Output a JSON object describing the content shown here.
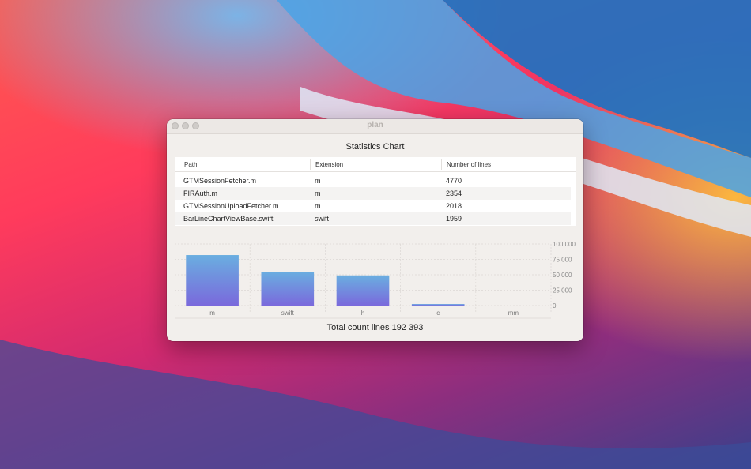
{
  "window": {
    "title": "plan"
  },
  "heading": "Statistics Chart",
  "table": {
    "columns": [
      "Path",
      "Extension",
      "Number of lines"
    ],
    "rows": [
      [
        "GTMSessionFetcher.m",
        "m",
        "4770"
      ],
      [
        "FIRAuth.m",
        "m",
        "2354"
      ],
      [
        "GTMSessionUploadFetcher.m",
        "m",
        "2018"
      ],
      [
        "BarLineChartViewBase.swift",
        "swift",
        "1959"
      ]
    ]
  },
  "chart_data": {
    "type": "bar",
    "categories": [
      "m",
      "swift",
      "h",
      "c",
      "mm"
    ],
    "values": [
      82000,
      55000,
      49000,
      2500,
      0
    ],
    "ylim": [
      0,
      100000
    ],
    "yticks": [
      "100 000",
      "75 000",
      "50 000",
      "25 000",
      "0"
    ],
    "ytick_values": [
      100000,
      75000,
      50000,
      25000,
      0
    ],
    "grid": true,
    "colors": {
      "bar_top": "#6aaee0",
      "bar_bottom": "#7a69dc"
    }
  },
  "footer": {
    "total_label": "Total count lines 192 393"
  }
}
